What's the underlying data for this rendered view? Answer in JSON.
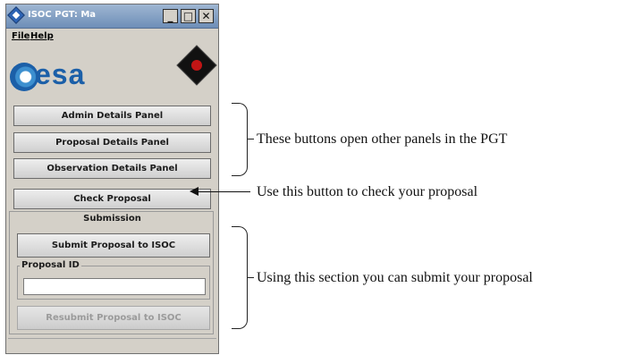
{
  "window": {
    "title": "ISOC PGT: Ma",
    "controls": {
      "minimize": "_",
      "maximize": "□",
      "close": "✕"
    }
  },
  "menu": {
    "file": "File",
    "help": "Help"
  },
  "logos": {
    "esa_text": "esa",
    "esa_icon": "esa-logo-icon",
    "mission_icon": "mission-logo-icon",
    "brand_color": "#1b5fa8"
  },
  "buttons": {
    "admin": "Admin Details Panel",
    "proposal": "Proposal Details Panel",
    "observation": "Observation Details Panel",
    "check": "Check Proposal"
  },
  "submission": {
    "title": "Submission",
    "submit_button": "Submit Proposal to ISOC",
    "proposal_id_label": "Proposal ID",
    "proposal_id_value": "",
    "resubmit_button": "Resubmit Proposal to ISOC"
  },
  "annotations": {
    "panels_note": "These buttons open other panels in the PGT",
    "check_note": "Use this button to check your proposal",
    "submission_note": "Using this section you can submit your proposal"
  }
}
